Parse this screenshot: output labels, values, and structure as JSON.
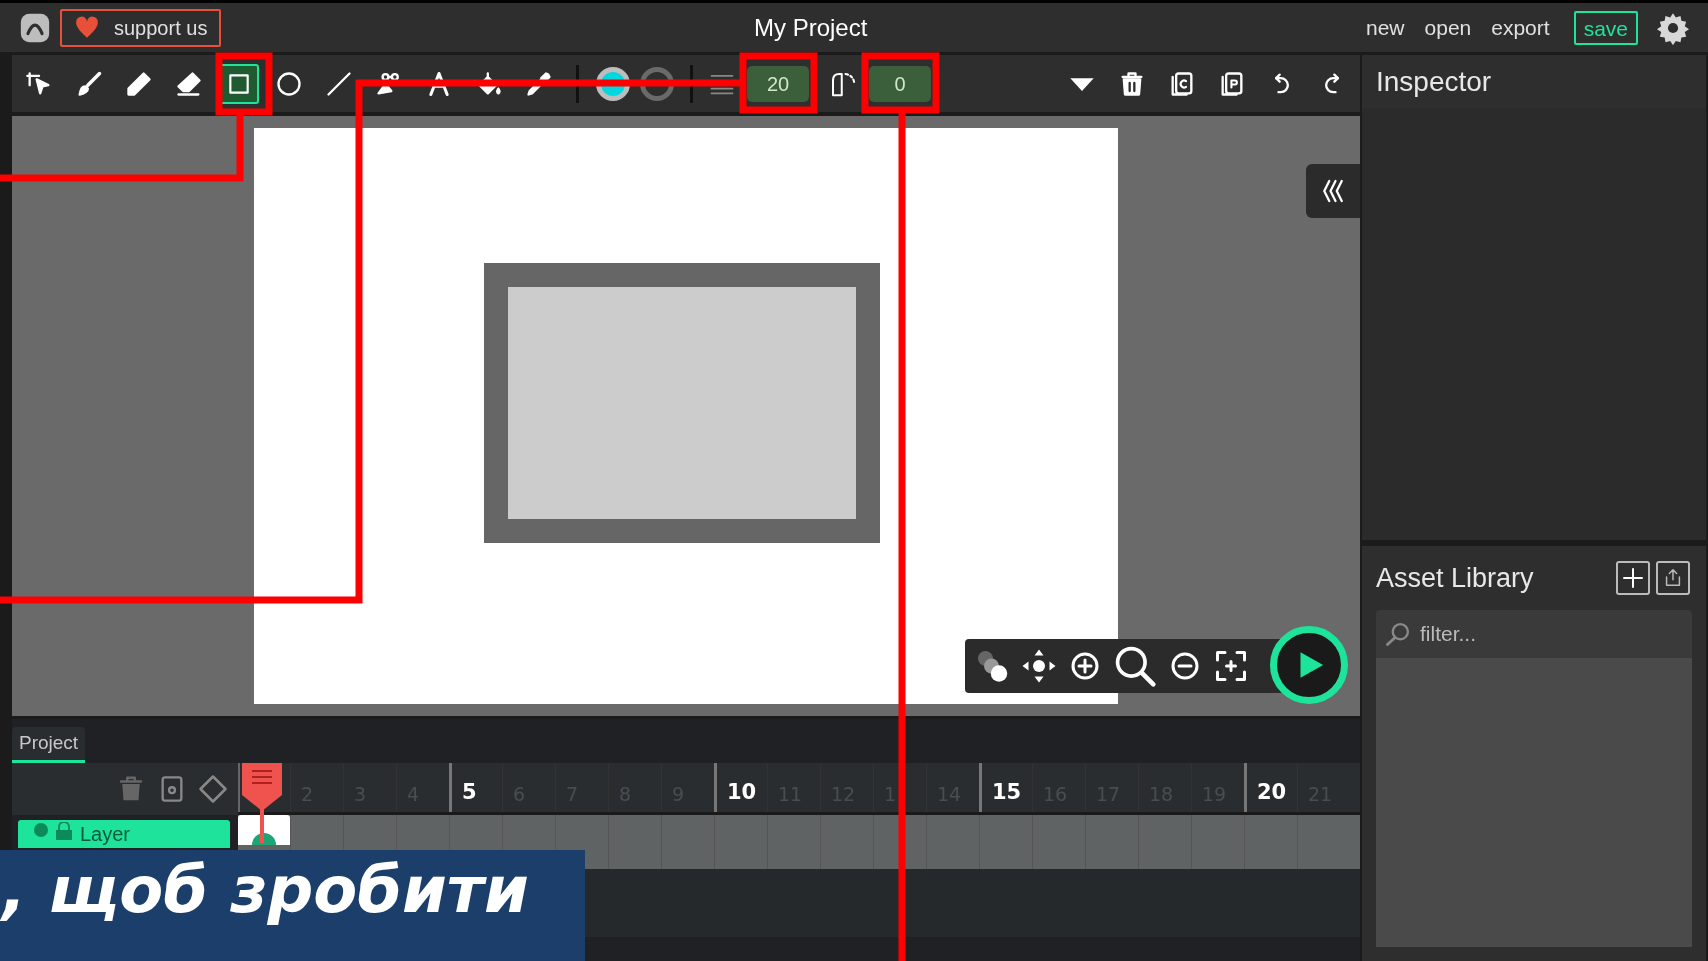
{
  "menubar": {
    "support_label": "support us",
    "title": "My Project",
    "menu": [
      {
        "label": "new",
        "kind": "plain"
      },
      {
        "label": "open",
        "kind": "plain"
      },
      {
        "label": "export",
        "kind": "plain"
      },
      {
        "label": "save",
        "kind": "primary"
      }
    ]
  },
  "toolbar": {
    "tools": [
      {
        "kind": "cursor",
        "selected": false
      },
      {
        "kind": "brush",
        "selected": false
      },
      {
        "kind": "pencil",
        "selected": false
      },
      {
        "kind": "eraser",
        "selected": false
      },
      {
        "kind": "rectangle",
        "selected": true
      },
      {
        "kind": "ellipse",
        "selected": false
      },
      {
        "kind": "line",
        "selected": false
      },
      {
        "kind": "path",
        "selected": false
      },
      {
        "kind": "text",
        "selected": false
      },
      {
        "kind": "fill",
        "selected": false
      },
      {
        "kind": "eyedropper",
        "selected": false
      }
    ],
    "brush_size": "20",
    "corner_radius": "0"
  },
  "inspector": {
    "title": "Inspector"
  },
  "asset_library": {
    "title": "Asset Library",
    "filter": {
      "placeholder": "filter..."
    }
  },
  "timeline": {
    "tabs": [
      {
        "label": "Project",
        "selected": true
      }
    ],
    "frame_numbers": [
      {
        "label": "2",
        "major": false
      },
      {
        "label": "3",
        "major": false
      },
      {
        "label": "4",
        "major": false
      },
      {
        "label": "5",
        "major": true
      },
      {
        "label": "6",
        "major": false
      },
      {
        "label": "7",
        "major": false
      },
      {
        "label": "8",
        "major": false
      },
      {
        "label": "9",
        "major": false
      },
      {
        "label": "10",
        "major": true
      },
      {
        "label": "11",
        "major": false
      },
      {
        "label": "12",
        "major": false
      },
      {
        "label": "1",
        "major": false
      },
      {
        "label": "14",
        "major": false
      },
      {
        "label": "15",
        "major": true
      },
      {
        "label": "16",
        "major": false
      },
      {
        "label": "17",
        "major": false
      },
      {
        "label": "18",
        "major": false
      },
      {
        "label": "19",
        "major": false
      },
      {
        "label": "20",
        "major": true
      },
      {
        "label": "21",
        "major": false
      }
    ],
    "layers": [
      {
        "name": "Layer",
        "selected": true
      }
    ]
  },
  "caption": ", щоб зробити"
}
